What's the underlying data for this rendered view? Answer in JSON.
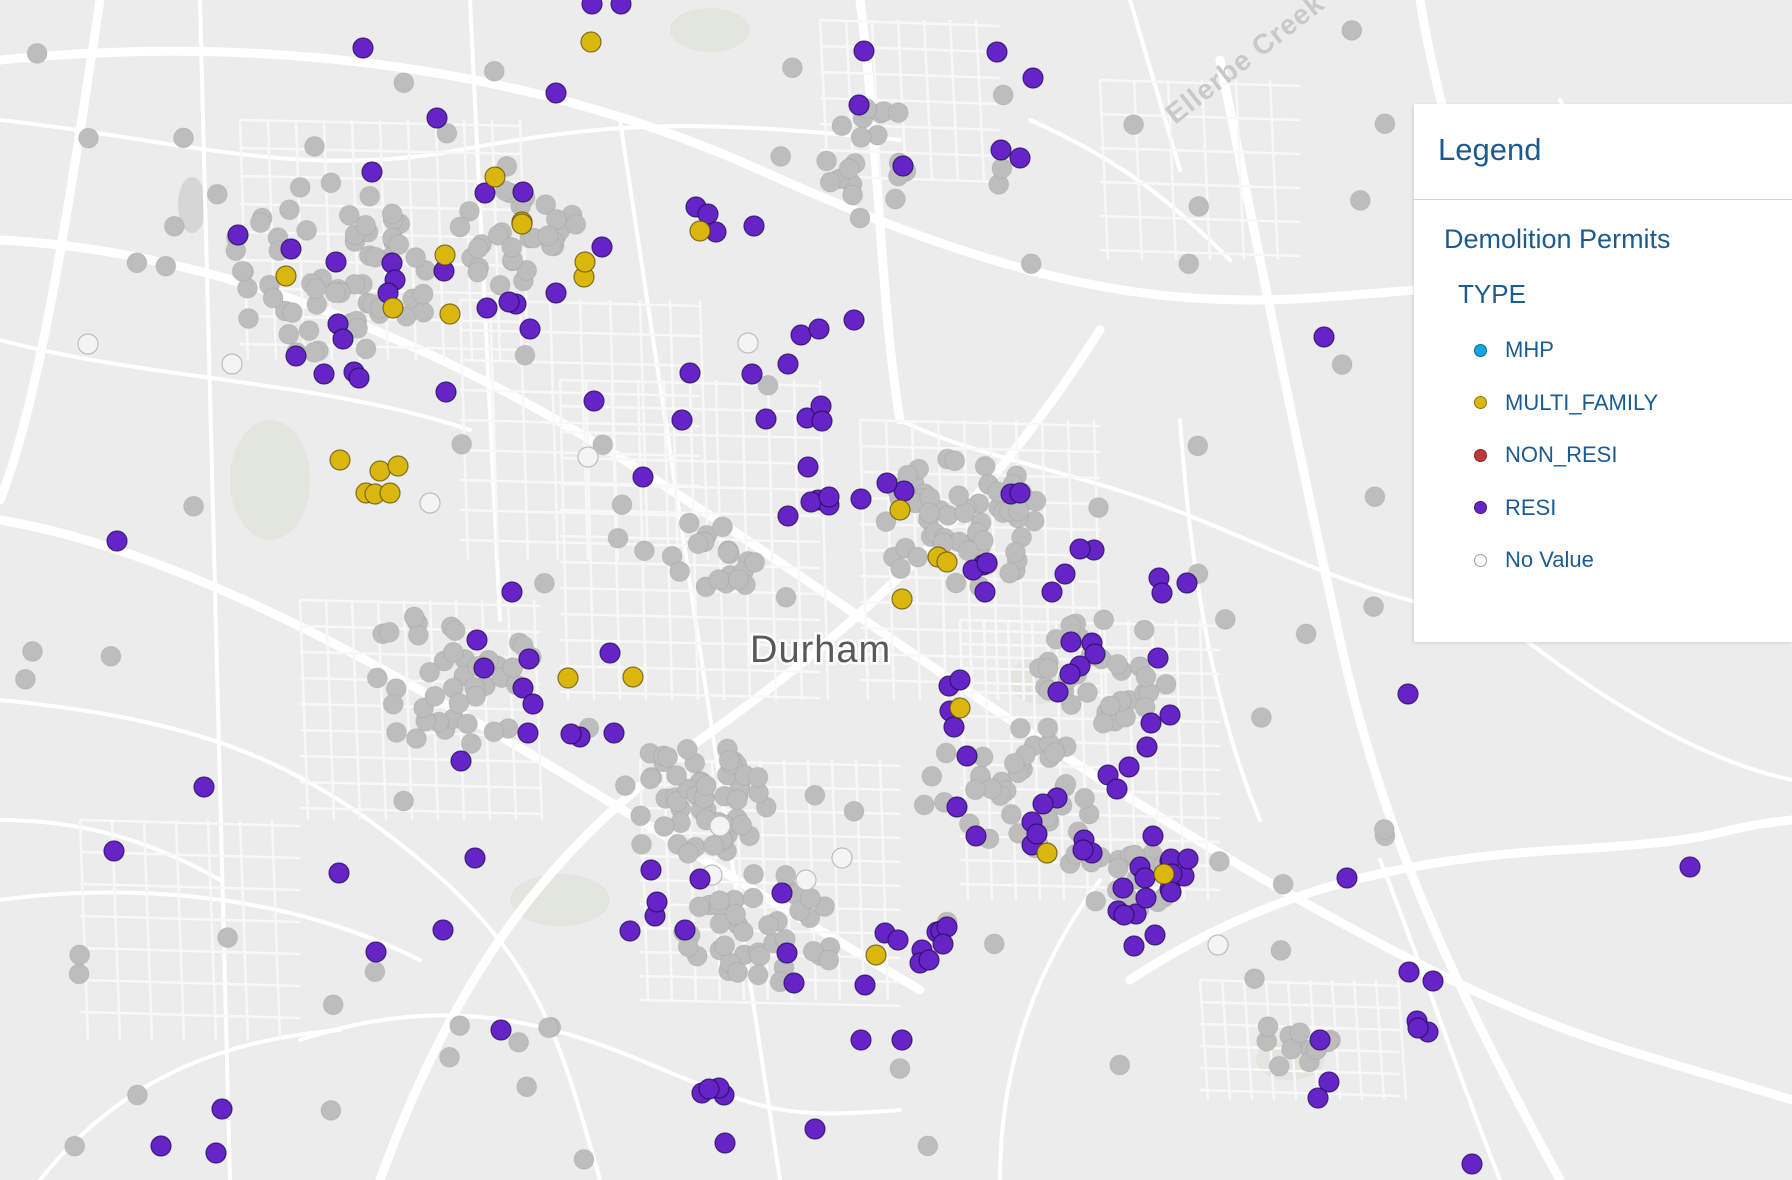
{
  "map": {
    "place_label": "Durham",
    "creek_label": "Ellerbe Creek"
  },
  "legend": {
    "title": "Legend",
    "layer_title": "Demolition Permits",
    "field_title": "TYPE",
    "items": [
      {
        "label": "MHP",
        "color": "#12a6e0",
        "icon": "filled-circle"
      },
      {
        "label": "MULTI_FAMILY",
        "color": "#d9b70f",
        "icon": "filled-circle"
      },
      {
        "label": "NON_RESI",
        "color": "#c0393a",
        "icon": "filled-circle"
      },
      {
        "label": "RESI",
        "color": "#6424c6",
        "icon": "filled-circle"
      },
      {
        "label": "No Value",
        "color": "#ffffff",
        "icon": "hollow-circle"
      }
    ]
  },
  "colors": {
    "map_background": "#ececec",
    "road": "#ffffff",
    "park": "#e2e6de",
    "no_value_point": "#bdbdbd"
  }
}
